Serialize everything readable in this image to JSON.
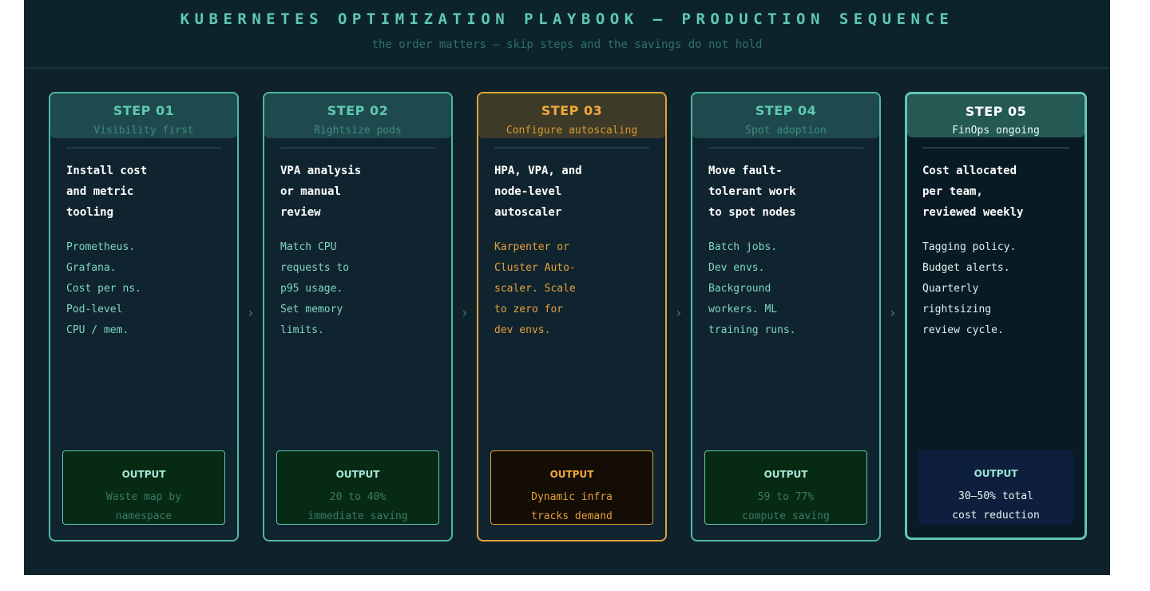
{
  "header": {
    "title": "KUBERNETES OPTIMIZATION PLAYBOOK — PRODUCTION SEQUENCE",
    "subtitle": "the order matters — skip steps and the savings do not hold"
  },
  "arrow_glyph": "›",
  "steps": [
    {
      "label": "STEP 01",
      "subtitle": "Visibility first",
      "title": "Install cost\nand metric\ntooling",
      "body": "Prometheus.\nGrafana.\nCost per ns.\nPod-level\nCPU / mem.",
      "output_label": "OUTPUT",
      "output_text": "Waste map by\nnamespace"
    },
    {
      "label": "STEP 02",
      "subtitle": "Rightsize pods",
      "title": "VPA analysis\nor manual\nreview",
      "body": "Match CPU\nrequests to\np95 usage.\nSet memory\nlimits.",
      "output_label": "OUTPUT",
      "output_text": "20 to 40%\nimmediate saving"
    },
    {
      "label": "STEP 03",
      "subtitle": "Configure autoscaling",
      "title": "HPA, VPA, and\nnode-level\nautoscaler",
      "body": "Karpenter or\nCluster Auto-\nscaler. Scale\nto zero for\ndev envs.",
      "output_label": "OUTPUT",
      "output_text": "Dynamic infra\ntracks demand"
    },
    {
      "label": "STEP 04",
      "subtitle": "Spot adoption",
      "title": "Move fault-\ntolerant work\nto spot nodes",
      "body": "Batch jobs.\nDev envs.\nBackground\nworkers. ML\ntraining runs.",
      "output_label": "OUTPUT",
      "output_text": "59 to 77%\ncompute saving"
    },
    {
      "label": "STEP 05",
      "subtitle": "FinOps ongoing",
      "title": "Cost allocated\nper team,\nreviewed weekly",
      "body": "Tagging policy.\nBudget alerts.\nQuarterly\nrightsizing\nreview cycle.",
      "output_label": "OUTPUT",
      "output_text": "30–50% total\ncost reduction"
    }
  ],
  "colors": {
    "accent_teal": "#5ec8b2",
    "accent_amber": "#e1a43a",
    "background": "#0f222b"
  }
}
